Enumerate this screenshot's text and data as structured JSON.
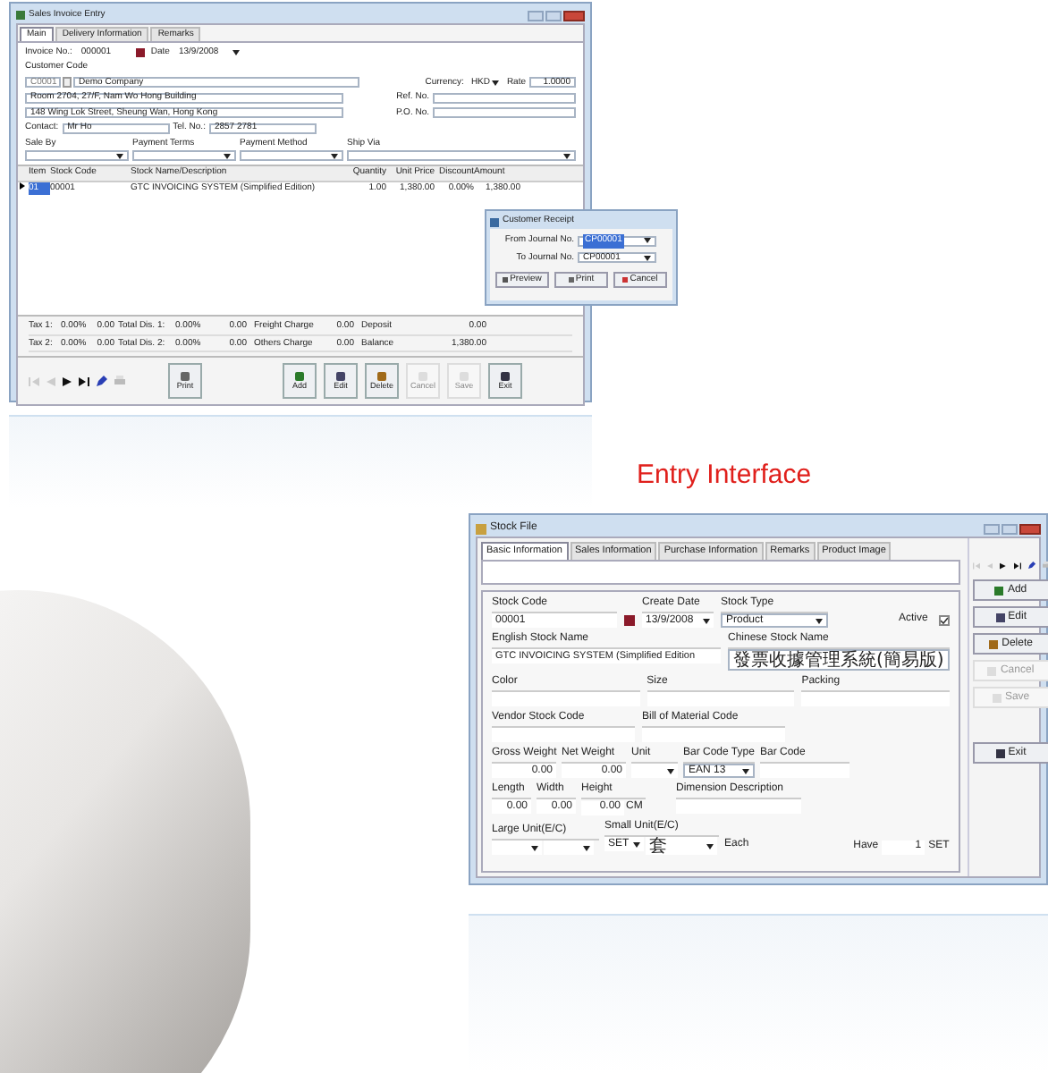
{
  "invoice_window": {
    "title": "Sales Invoice Entry",
    "tabs": [
      {
        "label": "Main",
        "selected": true
      },
      {
        "label": "Delivery Information",
        "selected": false
      },
      {
        "label": "Remarks",
        "selected": false
      }
    ],
    "invoice_no": {
      "label": "Invoice No.:",
      "value": "000001"
    },
    "date": {
      "label": "Date",
      "value": "13/9/2008"
    },
    "customer_code": {
      "label": "Customer Code",
      "value": "C0001",
      "name": "Demo Company"
    },
    "currency": {
      "label": "Currency:",
      "value": "HKD"
    },
    "rate": {
      "label": "Rate",
      "value": "1.0000"
    },
    "address": [
      "Room 2704, 27/F, Nam Wo Hong Building",
      "148 Wing Lok Street, Sheung Wan, Hong Kong"
    ],
    "ref_no": {
      "label": "Ref. No."
    },
    "po_no": {
      "label": "P.O. No."
    },
    "contact": {
      "label": "Contact:",
      "value": "Mr Ho"
    },
    "tel": {
      "label": "Tel. No.:",
      "value": "2857 2781"
    },
    "dropdowns": [
      {
        "label": "Sale By"
      },
      {
        "label": "Payment Terms"
      },
      {
        "label": "Payment Method"
      },
      {
        "label": "Ship Via"
      }
    ],
    "grid": {
      "columns": [
        "Item",
        "Stock Code",
        "Stock Name/Description",
        "Quantity",
        "Unit Price",
        "Discount",
        "Amount"
      ],
      "rows": [
        {
          "selected": true,
          "cells": [
            "01",
            "00001",
            "GTC INVOICING SYSTEM (Simplified Edition)",
            "1.00",
            "1,380.00",
            "0.00%",
            "1,380.00"
          ]
        }
      ]
    },
    "totals": [
      [
        "Tax 1:",
        "0.00%",
        "0.00",
        "Total Dis. 1:",
        "0.00%",
        "0.00",
        "Freight Charge",
        "0.00",
        "Deposit",
        "0.00"
      ],
      [
        "Tax 2:",
        "0.00%",
        "0.00",
        "Total Dis. 2:",
        "0.00%",
        "0.00",
        "Others Charge",
        "0.00",
        "Balance",
        "1,380.00"
      ]
    ],
    "buttons": [
      {
        "label": "Print",
        "disabled": false
      },
      {
        "label": "Add",
        "disabled": false
      },
      {
        "label": "Edit",
        "disabled": false
      },
      {
        "label": "Delete",
        "disabled": false
      },
      {
        "label": "Cancel",
        "disabled": true
      },
      {
        "label": "Save",
        "disabled": true
      },
      {
        "label": "Exit",
        "disabled": false
      }
    ]
  },
  "receipt_dialog": {
    "title": "Customer Receipt",
    "fields": [
      {
        "label": "From Journal No.",
        "value": "CP00001",
        "selected": true
      },
      {
        "label": "To Journal No.",
        "value": "CP00001",
        "selected": false
      }
    ],
    "buttons": [
      "Preview",
      "Print",
      "Cancel"
    ]
  },
  "heading": "Entry Interface",
  "stock_window": {
    "title": "Stock File",
    "tabs": [
      {
        "label": "Basic Information",
        "selected": true
      },
      {
        "label": "Sales Information",
        "selected": false
      },
      {
        "label": "Purchase Information",
        "selected": false
      },
      {
        "label": "Remarks",
        "selected": false
      },
      {
        "label": "Product Image",
        "selected": false
      }
    ],
    "stock_code": {
      "label": "Stock Code",
      "value": "00001"
    },
    "create_date": {
      "label": "Create Date",
      "value": "13/9/2008"
    },
    "stock_type": {
      "label": "Stock Type",
      "value": "Product"
    },
    "active": {
      "label": "Active",
      "checked": true
    },
    "english_name": {
      "label": "English Stock Name",
      "value": "GTC INVOICING SYSTEM (Simplified Edition"
    },
    "chinese_name": {
      "label": "Chinese Stock Name",
      "value": "發票收據管理系統(簡易版)"
    },
    "row3": [
      {
        "label": "Color"
      },
      {
        "label": "Size"
      },
      {
        "label": "Packing"
      }
    ],
    "row4": [
      {
        "label": "Vendor Stock Code"
      },
      {
        "label": "Bill of Material Code"
      }
    ],
    "gross_weight": {
      "label": "Gross Weight",
      "value": "0.00"
    },
    "net_weight": {
      "label": "Net Weight",
      "value": "0.00"
    },
    "unit": {
      "label": "Unit"
    },
    "bar_code_type": {
      "label": "Bar Code Type",
      "value": "EAN 13"
    },
    "bar_code": {
      "label": "Bar Code"
    },
    "length": {
      "label": "Length",
      "value": "0.00"
    },
    "width": {
      "label": "Width",
      "value": "0.00"
    },
    "height": {
      "label": "Height",
      "value": "0.00",
      "unit": "CM"
    },
    "dimension": {
      "label": "Dimension Description"
    },
    "large_unit": {
      "label": "Large Unit(E/C)"
    },
    "small_unit": {
      "label": "Small Unit(E/C)",
      "value": "SET",
      "value2": "套"
    },
    "each": "Each",
    "have": {
      "label": "Have",
      "value": "1",
      "unit": "SET"
    },
    "buttons": [
      {
        "label": "Add",
        "disabled": false
      },
      {
        "label": "Edit",
        "disabled": false
      },
      {
        "label": "Delete",
        "disabled": false
      },
      {
        "label": "Cancel",
        "disabled": true
      },
      {
        "label": "Save",
        "disabled": true
      },
      {
        "label": "Exit",
        "disabled": false
      }
    ]
  }
}
